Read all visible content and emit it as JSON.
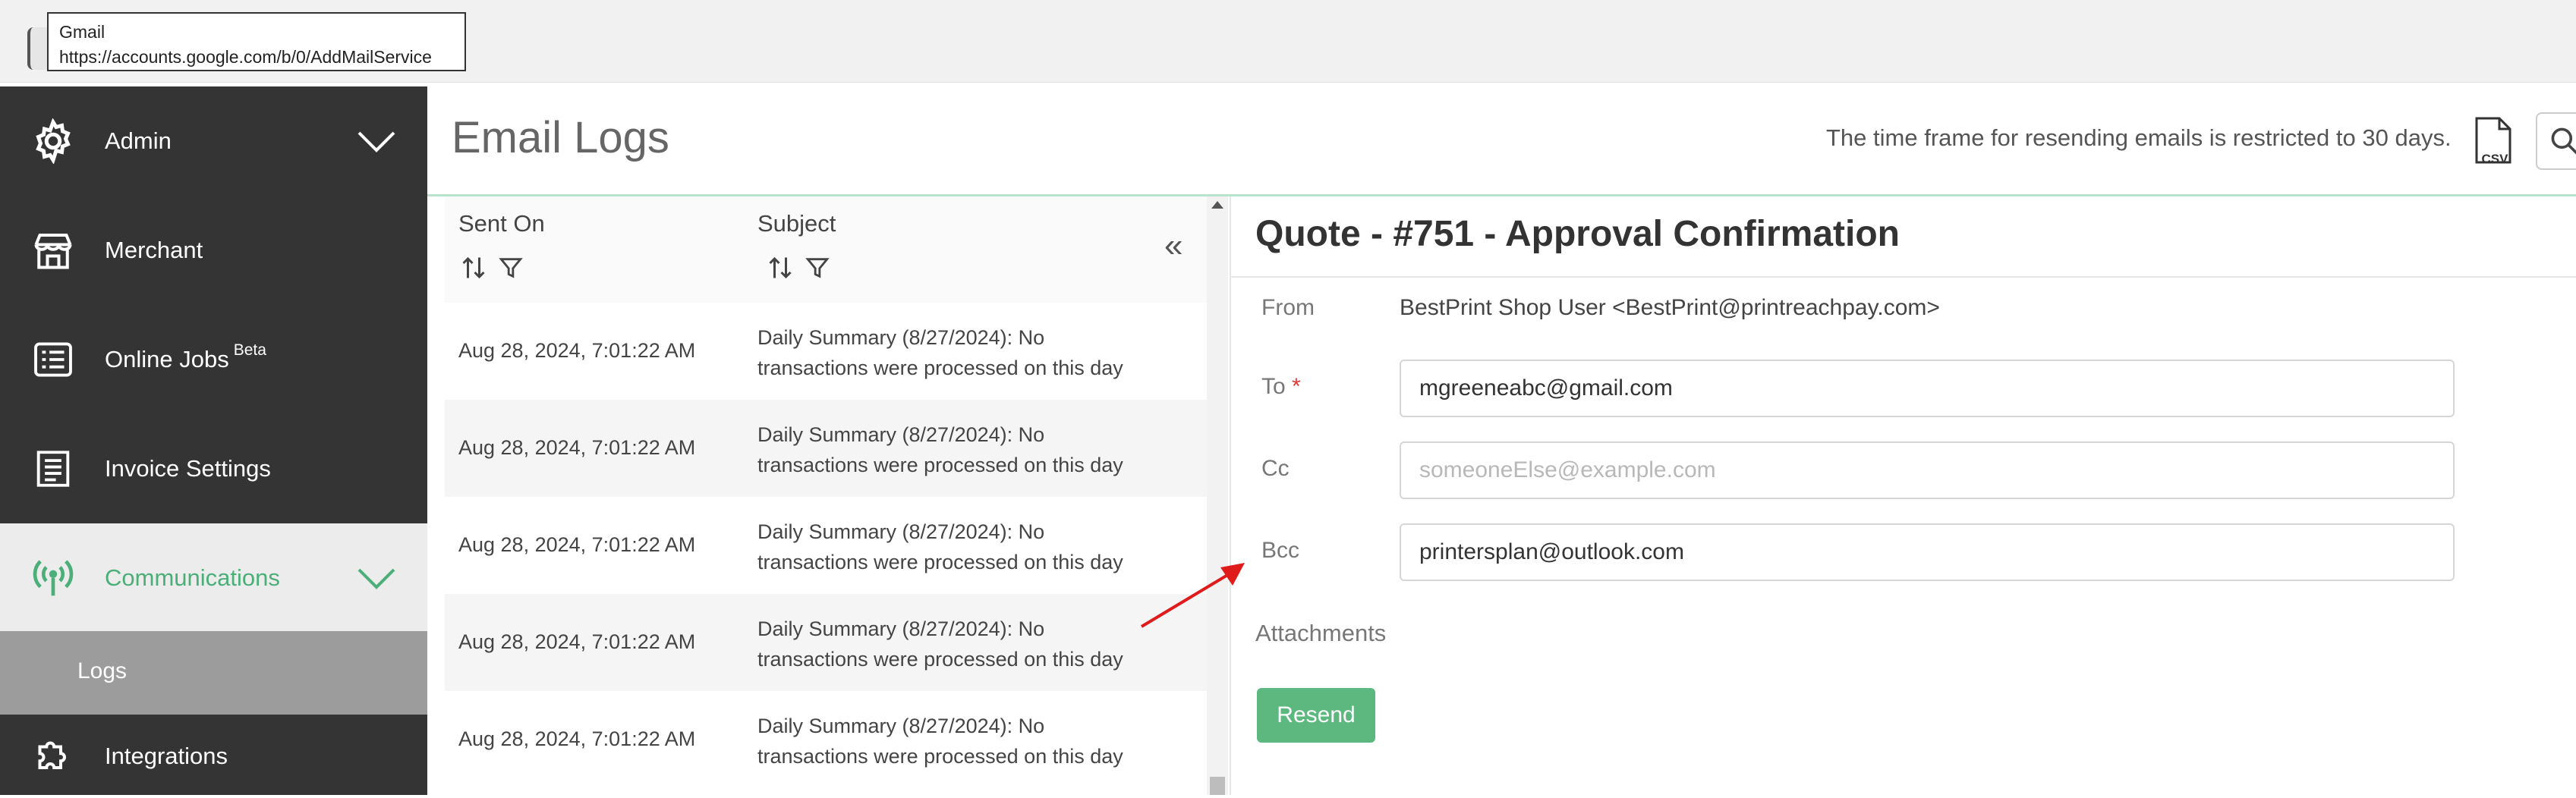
{
  "tooltip": {
    "title": "Gmail",
    "url": "https://accounts.google.com/b/0/AddMailService"
  },
  "sidebar": {
    "items": [
      {
        "label": "Admin",
        "icon": "gear-icon",
        "has_chevron": true
      },
      {
        "label": "Merchant",
        "icon": "store-icon"
      },
      {
        "label": "Online Jobs",
        "badge": "Beta",
        "icon": "list-icon"
      },
      {
        "label": "Invoice Settings",
        "icon": "receipt-icon"
      },
      {
        "label": "Communications",
        "icon": "broadcast-icon",
        "active": true,
        "has_chevron": true
      },
      {
        "label": "Integrations",
        "icon": "puzzle-icon"
      }
    ],
    "sub_item": {
      "label": "Logs"
    }
  },
  "header": {
    "title": "Email Logs",
    "notice": "The time frame for resending emails is restricted to 30 days.",
    "csv_label": "CSV"
  },
  "list": {
    "columns": [
      {
        "label": "Sent On"
      },
      {
        "label": "Subject"
      }
    ],
    "collapse_symbol": "«",
    "rows": [
      {
        "sent_on": "Aug 28, 2024, 7:01:22 AM",
        "subject": "Daily Summary (8/27/2024): No transactions were processed on this day"
      },
      {
        "sent_on": "Aug 28, 2024, 7:01:22 AM",
        "subject": "Daily Summary (8/27/2024): No transactions were processed on this day"
      },
      {
        "sent_on": "Aug 28, 2024, 7:01:22 AM",
        "subject": "Daily Summary (8/27/2024): No transactions were processed on this day"
      },
      {
        "sent_on": "Aug 28, 2024, 7:01:22 AM",
        "subject": "Daily Summary (8/27/2024): No transactions were processed on this day"
      },
      {
        "sent_on": "Aug 28, 2024, 7:01:22 AM",
        "subject": "Daily Summary (8/27/2024): No transactions were processed on this day"
      }
    ]
  },
  "detail": {
    "title": "Quote - #751 - Approval Confirmation",
    "from_label": "From",
    "from_value": "BestPrint Shop User <BestPrint@printreachpay.com>",
    "to_label": "To",
    "required_mark": "*",
    "to_value": "mgreeneabc@gmail.com",
    "cc_label": "Cc",
    "cc_placeholder": "someoneElse@example.com",
    "bcc_label": "Bcc",
    "bcc_value": "printersplan@outlook.com",
    "attachments_label": "Attachments",
    "resend_label": "Resend"
  },
  "colors": {
    "accent": "#5cb87f",
    "sidebar_bg": "#343434",
    "active_text": "#4caf79",
    "annotation_arrow": "#e01b1b"
  }
}
